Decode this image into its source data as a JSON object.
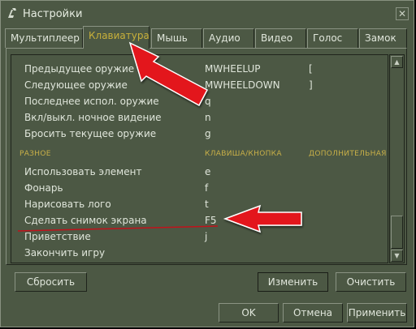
{
  "window": {
    "title": "Настройки",
    "close_glyph": "✕",
    "icon": "cs-logo-icon"
  },
  "tabs": [
    {
      "label": "Мультиплеер",
      "active": false
    },
    {
      "label": "Клавиатура",
      "active": true
    },
    {
      "label": "Мышь",
      "active": false
    },
    {
      "label": "Аудио",
      "active": false
    },
    {
      "label": "Видео",
      "active": false
    },
    {
      "label": "Голос",
      "active": false
    },
    {
      "label": "Замок",
      "active": false
    }
  ],
  "rows": [
    {
      "action": "Предыдущее оружие",
      "key": "MWHEELUP",
      "alt": "["
    },
    {
      "action": "Следующее оружие",
      "key": "MWHEELDOWN",
      "alt": "]"
    },
    {
      "action": "Последнее испол. оружие",
      "key": "q",
      "alt": ""
    },
    {
      "action": "Вкл/выкл. ночное видение",
      "key": "n",
      "alt": ""
    },
    {
      "action": "Бросить текущее оружие",
      "key": "g",
      "alt": ""
    }
  ],
  "section_header": {
    "col1": "РАЗНОЕ",
    "col2": "КЛАВИША/КНОПКА",
    "col3": "ДОПОЛНИТЕЛЬНАЯ"
  },
  "rows2": [
    {
      "action": "Использовать элемент",
      "key": "e",
      "alt": ""
    },
    {
      "action": "Фонарь",
      "key": "f",
      "alt": ""
    },
    {
      "action": "Нарисовать лого",
      "key": "t",
      "alt": ""
    },
    {
      "action": "Сделать снимок экрана",
      "key": "F5",
      "alt": ""
    },
    {
      "action": "Приветствие",
      "key": "j",
      "alt": ""
    },
    {
      "action": "Закончить игру",
      "key": "",
      "alt": ""
    }
  ],
  "buttons": {
    "reset": "Сбросить",
    "change": "Изменить",
    "clear": "Очистить",
    "ok": "OK",
    "cancel": "Отмена",
    "apply": "Применить"
  },
  "scrollbar": {
    "up_glyph": "▲",
    "down_glyph": "▼"
  },
  "annotation_color": "#e3141b"
}
